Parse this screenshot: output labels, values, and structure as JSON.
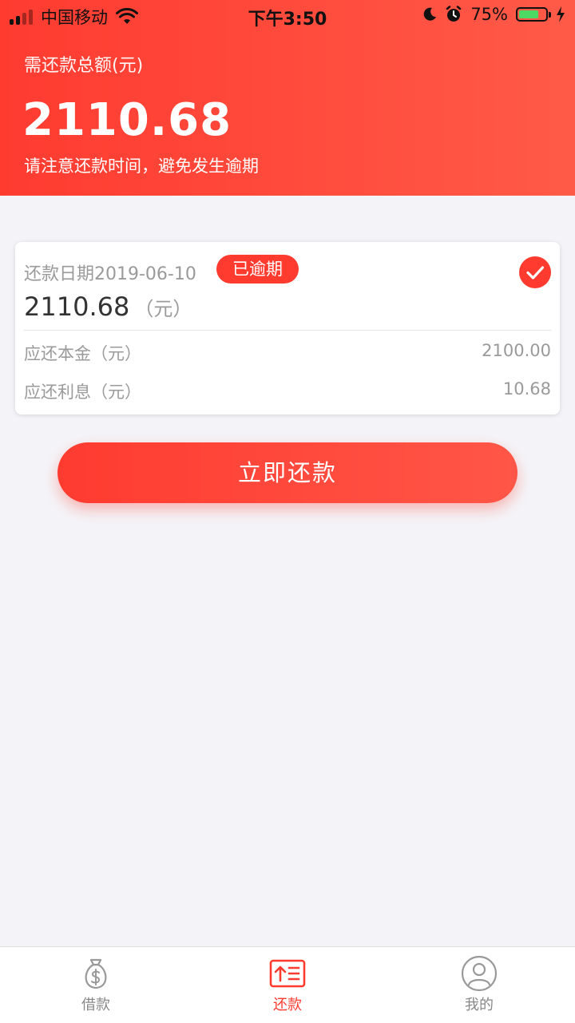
{
  "status_bar": {
    "carrier": "中国移动",
    "time": "下午3:50",
    "battery_percent": "75%",
    "battery_level": 0.75
  },
  "header": {
    "label": "需还款总额(元)",
    "amount": "2110.68",
    "tip": "请注意还款时间，避免发生逾期"
  },
  "card": {
    "date_text": "还款日期2019-06-10",
    "badge": "已逾期",
    "amount": "2110.68",
    "unit": "（元）",
    "principal_label": "应还本金（元）",
    "principal_value": "2100.00",
    "interest_label": "应还利息（元）",
    "interest_value": "10.68"
  },
  "actions": {
    "repay_label": "立即还款"
  },
  "tabs": [
    {
      "label": "借款",
      "icon": "money-bag-icon",
      "active": false
    },
    {
      "label": "还款",
      "icon": "repay-list-icon",
      "active": true
    },
    {
      "label": "我的",
      "icon": "user-icon",
      "active": false
    }
  ],
  "colors": {
    "accent": "#ff3b30",
    "background": "#f4f4f8",
    "battery": "#4cd964"
  }
}
